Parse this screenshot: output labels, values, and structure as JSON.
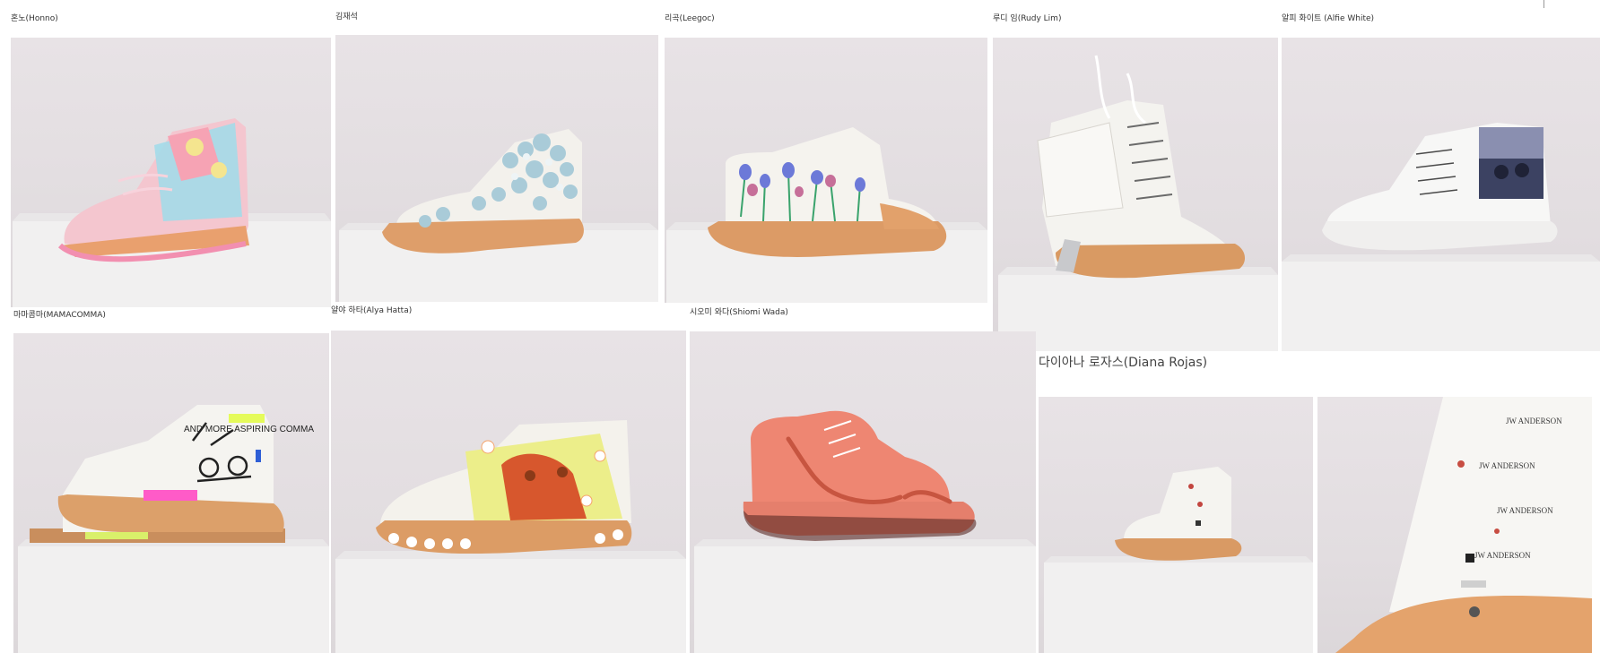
{
  "gallery": {
    "items": [
      {
        "artist": "혼노(Honno)"
      },
      {
        "artist": "김재석"
      },
      {
        "artist": "리곡(Leegoc)"
      },
      {
        "artist": "루디 임(Rudy Lim)"
      },
      {
        "artist": "알피 화이트 (Alfie White)"
      },
      {
        "artist": "마마콤마(MAMACOMMA)"
      },
      {
        "artist": "얄야 하타(Alya Hatta)"
      },
      {
        "artist": "시오미 와다(Shiomi Wada)"
      },
      {
        "artist": "다이아나 로자스(Diana Rojas)"
      }
    ],
    "shoe_texts": {
      "mamacomma_scribble": "AND MORE ASPIRING COMMA",
      "brand": "JW ANDERSON"
    }
  },
  "colors": {
    "backdrop": "#e4dfe2",
    "pedestal": "#f2f1f1",
    "sole_tan": "#d99a66",
    "canvas_white": "#f4f2ee"
  }
}
